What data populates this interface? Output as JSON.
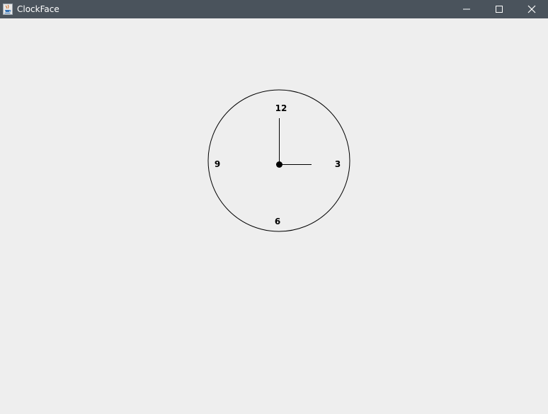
{
  "window": {
    "title": "ClockFace",
    "app_icon": "java-cup-icon",
    "controls": {
      "minimize_icon": "minimize-icon",
      "maximize_icon": "maximize-icon",
      "close_icon": "close-icon"
    },
    "titlebar_color": "#4a535c",
    "background_color": "#eeeeee"
  },
  "clock": {
    "numerals": {
      "twelve": "12",
      "three": "3",
      "six": "6",
      "nine": "9"
    },
    "hour_hand_points_to": 3,
    "minute_hand_points_to": 12
  }
}
